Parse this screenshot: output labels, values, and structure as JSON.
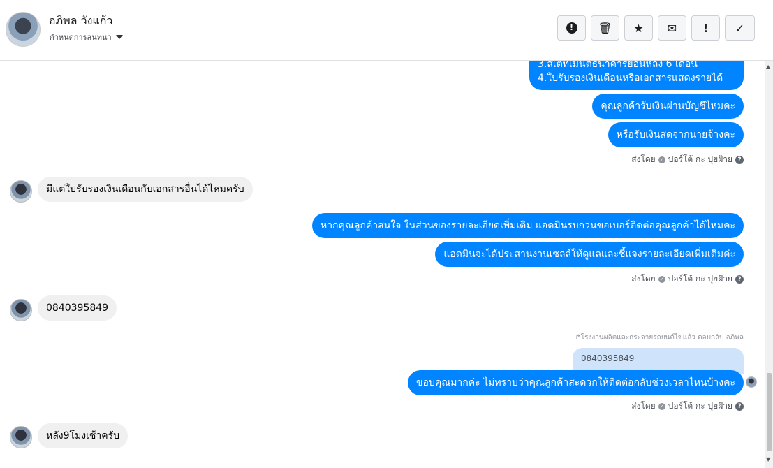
{
  "header": {
    "contact_name": "อภิพล วังแก้ว",
    "assign_label": "กำหนดการสนทนา",
    "toolbar": [
      {
        "name": "report-button",
        "icon": "exclamation-circle-icon",
        "glyph": "●"
      },
      {
        "name": "delete-button",
        "icon": "trash-icon",
        "glyph": "🗑"
      },
      {
        "name": "star-button",
        "icon": "star-icon",
        "glyph": "★"
      },
      {
        "name": "unread-button",
        "icon": "envelope-icon",
        "glyph": "✉"
      },
      {
        "name": "spam-button",
        "icon": "exclamation-icon",
        "glyph": "!"
      },
      {
        "name": "done-button",
        "icon": "check-icon",
        "glyph": "✓"
      }
    ]
  },
  "messages": {
    "top_list_line1": "3.สเตทเม้นต์ธนาคารย้อนหลัง 6 เดือน",
    "top_list_line2": "4.ใบรับรองเงินเดือนหรือเอกสารแสดงรายได้",
    "out_1": "คุณลูกค้ารับเงินผ่านบัญชีไหมคะ",
    "out_2": "หรือรับเงินสดจากนายจ้างคะ",
    "in_1": "มีแต่ใบรับรองเงินเดือนกับเอกสารอื่นได้ไหมครับ",
    "out_3": "หากคุณลูกค้าสนใจ ในส่วนของรายละเอียดเพิ่มเติม แอดมินรบกวนขอเบอร์ติดต่อคุณลูกค้าได้ไหมคะ",
    "out_4": "แอดมินจะได้ประสานงานเซลล์ให้ดูแลและชี้แจงรายละเอียดเพิ่มเติมค่ะ",
    "in_2": "0840395849",
    "reply_note": "↱โรงงานผลิตและกระจายรถยนต์ไข่แล้ว ตอบกลับ อภิพล",
    "quoted_text": "0840395849",
    "out_5": "ขอบคุณมากค่ะ ไม่ทราบว่าคุณลูกค้าสะดวกให้ติดต่อกลับช่วงเวลาไหนบ้างคะ",
    "in_3": "หลัง9โมงเช้าครับ",
    "sent_by": "ส่งโดย",
    "sender_name": "ปอร์โต้ กะ ปุยฝ้าย"
  }
}
